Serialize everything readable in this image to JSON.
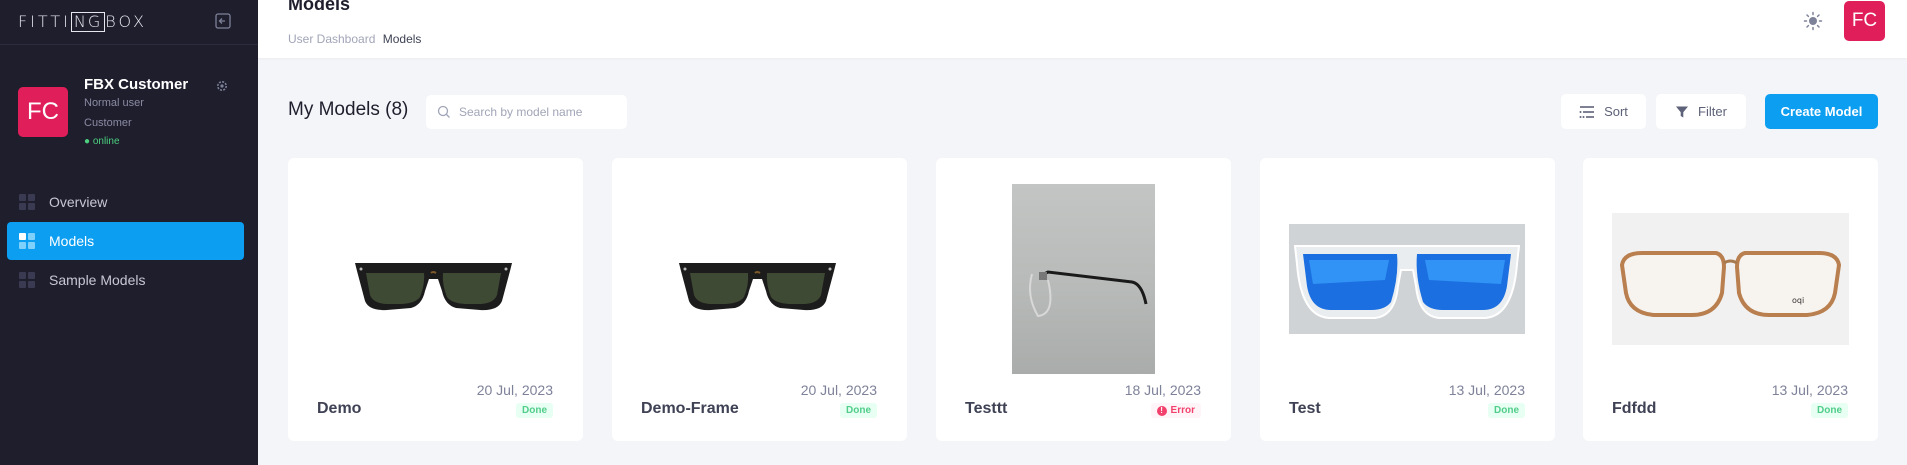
{
  "app": {
    "logo": "FITTINGBOX",
    "logo_left": "FITTI",
    "logo_box": "NG",
    "logo_right": "BOX"
  },
  "sidebar": {
    "user": {
      "initials": "FC",
      "name": "FBX Customer",
      "role": "Normal user",
      "type": "Customer",
      "status": "● online"
    },
    "items": [
      {
        "label": "Overview",
        "active": false
      },
      {
        "label": "Models",
        "active": true
      },
      {
        "label": "Sample Models",
        "active": false
      }
    ]
  },
  "header": {
    "title": "Models",
    "breadcrumb": {
      "parent": "User Dashboard",
      "current": "Models"
    },
    "avatar_initials": "FC"
  },
  "toolbar": {
    "title": "My Models (8)",
    "search_placeholder": "Search by model name",
    "sort_label": "Sort",
    "filter_label": "Filter",
    "create_label": "Create Model"
  },
  "cards": [
    {
      "name": "Demo",
      "date": "20 Jul, 2023",
      "status": "Done",
      "image": "black-sunglasses"
    },
    {
      "name": "Demo-Frame",
      "date": "20 Jul, 2023",
      "status": "Done",
      "image": "black-sunglasses"
    },
    {
      "name": "Testtt",
      "date": "18 Jul, 2023",
      "status": "Error",
      "image": "rimless-glasses-side"
    },
    {
      "name": "Test",
      "date": "13 Jul, 2023",
      "status": "Done",
      "image": "blue-mirror-sunglasses"
    },
    {
      "name": "Fdfdd",
      "date": "13 Jul, 2023",
      "status": "Done",
      "image": "tortoise-glasses"
    }
  ],
  "colors": {
    "sidebar_bg": "#1e1e2d",
    "accent": "#0c9ef1",
    "avatar": "#e01e5a",
    "done": "#50cd89",
    "error": "#f1416c"
  }
}
